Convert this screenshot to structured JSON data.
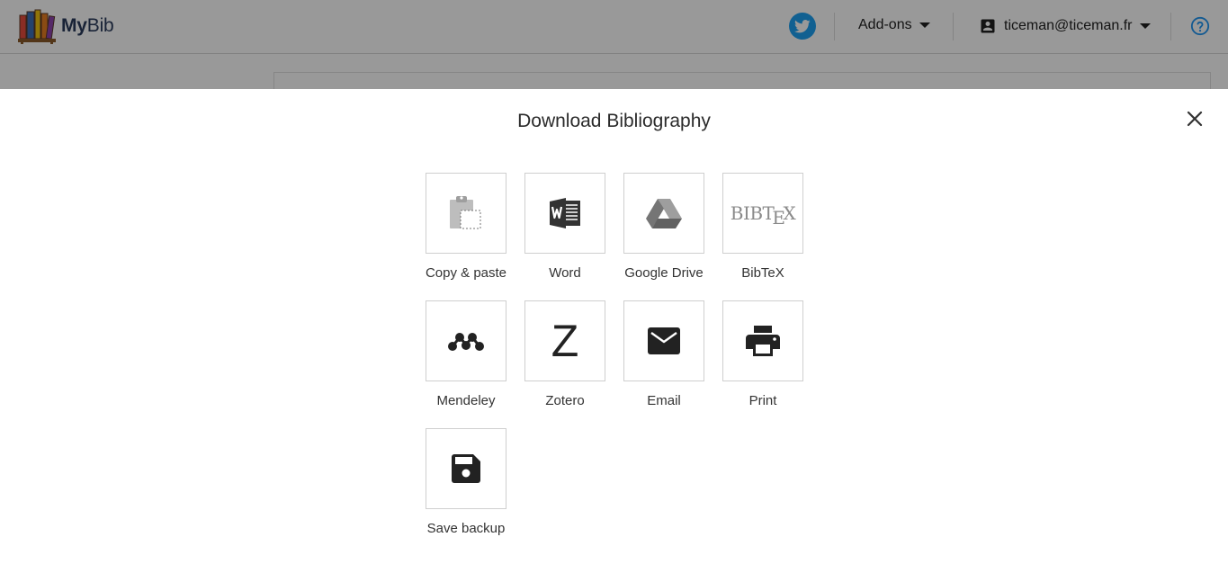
{
  "app": {
    "brand": {
      "name_bold": "My",
      "name_rest": "Bib"
    },
    "header": {
      "twitter_icon": "twitter-icon",
      "addons_label": "Add-ons",
      "account_email": "ticeman@ticeman.fr",
      "help_icon": "help-circle-icon"
    }
  },
  "modal": {
    "title": "Download Bibliography",
    "close_icon": "close-icon",
    "options": [
      {
        "label": "Copy & paste",
        "icon": "clipboard-icon"
      },
      {
        "label": "Word",
        "icon": "word-icon"
      },
      {
        "label": "Google Drive",
        "icon": "google-drive-icon"
      },
      {
        "label": "BibTeX",
        "icon": "bibtex-icon",
        "logo_text": [
          "BIBT",
          "E",
          "X"
        ]
      },
      {
        "label": "Mendeley",
        "icon": "mendeley-icon"
      },
      {
        "label": "Zotero",
        "icon": "zotero-icon",
        "logo_text": "Z"
      },
      {
        "label": "Email",
        "icon": "email-icon"
      },
      {
        "label": "Print",
        "icon": "print-icon"
      },
      {
        "label": "Save backup",
        "icon": "save-icon"
      }
    ]
  },
  "colors": {
    "twitter": "#1da1f2",
    "help": "#2196f3",
    "overlay": "rgba(0,0,0,0.4)",
    "brand_text": "#2a3b5c"
  }
}
